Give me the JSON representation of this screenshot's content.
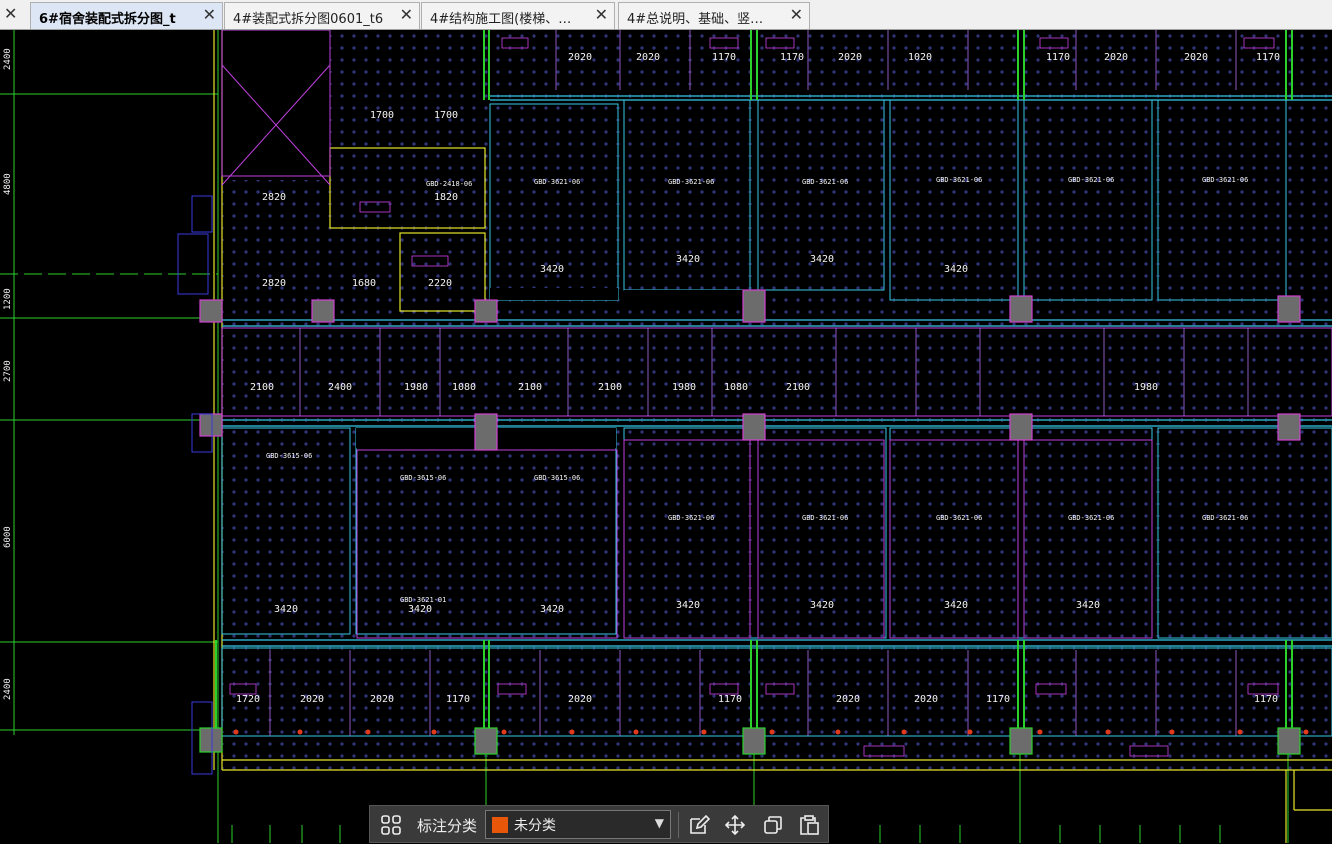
{
  "tabs": [
    {
      "label": "6#宿舍装配式拆分图_t",
      "active": true
    },
    {
      "label": "4#装配式拆分图0601_t6",
      "active": false
    },
    {
      "label": "4#结构施工图(楼梯、…",
      "active": false
    },
    {
      "label": "4#总说明、基础、竖…",
      "active": false
    }
  ],
  "left_dims": [
    "2400",
    "4800",
    "1200",
    "2700",
    "6000",
    "2400"
  ],
  "panels": {
    "top_row": [
      "2020",
      "2020",
      "1170",
      "2020",
      "1170",
      "1020",
      "2020",
      "1170",
      "2020",
      "1170"
    ],
    "bottom_row": [
      "1720",
      "2020",
      "2020",
      "1170",
      "2020",
      "1170",
      "2020",
      "2020",
      "1170",
      "1170"
    ],
    "upper_sizes": [
      "3420",
      "3420",
      "3420",
      "3420"
    ],
    "lower_sizes": [
      "3420",
      "3420",
      "3420",
      "3420",
      "3420",
      "3420",
      "3420"
    ],
    "strip_sizes": [
      "2100",
      "2400",
      "1980",
      "1080",
      "2100",
      "2100",
      "1980",
      "1080",
      "2100",
      "1980"
    ],
    "codes": {
      "a": "GBD-3621-06",
      "b": "GBD-3615-06",
      "c": "GBD-2721-10",
      "d": "GBD-2418-06",
      "e": "GBD-3621-01"
    },
    "misc": [
      "2820",
      "1700",
      "1700",
      "1820",
      "2820",
      "1680",
      "2220"
    ]
  },
  "toolbar": {
    "category_label": "标注分类",
    "category_value": "未分类",
    "swatch_color": "#e8560a"
  },
  "icons": [
    "grid-icon",
    "edit-icon",
    "move-icon",
    "copy-icon",
    "paste-icon"
  ]
}
